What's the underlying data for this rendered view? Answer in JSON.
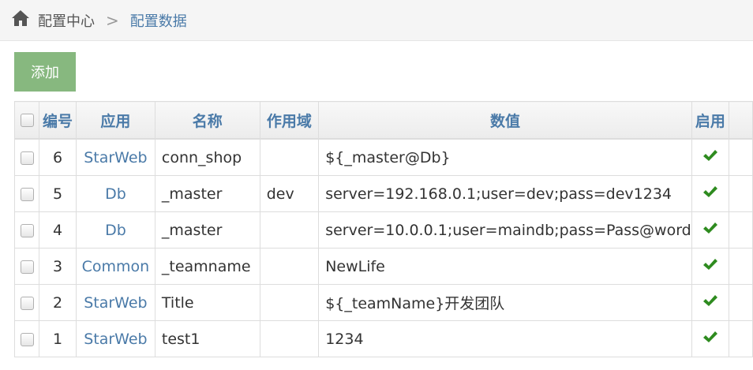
{
  "breadcrumb": {
    "home_label": "配置中心",
    "separator": ">",
    "current": "配置数据"
  },
  "toolbar": {
    "add_label": "添加"
  },
  "table": {
    "headers": {
      "id": "编号",
      "app": "应用",
      "name": "名称",
      "scope": "作用域",
      "value": "数值",
      "enabled": "启用"
    },
    "rows": [
      {
        "id": "6",
        "app": "StarWeb",
        "name": "conn_shop",
        "scope": "",
        "value": "${_master@Db}",
        "enabled": true
      },
      {
        "id": "5",
        "app": "Db",
        "name": "_master",
        "scope": "dev",
        "value": "server=192.168.0.1;user=dev;pass=dev1234",
        "enabled": true
      },
      {
        "id": "4",
        "app": "Db",
        "name": "_master",
        "scope": "",
        "value": "server=10.0.0.1;user=maindb;pass=Pass@word",
        "enabled": true
      },
      {
        "id": "3",
        "app": "Common",
        "name": "_teamname",
        "scope": "",
        "value": "NewLife",
        "enabled": true
      },
      {
        "id": "2",
        "app": "StarWeb",
        "name": "Title",
        "scope": "",
        "value": "${_teamName}开发团队",
        "enabled": true
      },
      {
        "id": "1",
        "app": "StarWeb",
        "name": "test1",
        "scope": "",
        "value": "1234",
        "enabled": true
      }
    ]
  },
  "colors": {
    "accent": "#4a7aa8",
    "add_button": "#87b87f",
    "check": "#2e8b1f"
  },
  "icons": {
    "home": "home-icon",
    "enabled": "check-icon"
  }
}
